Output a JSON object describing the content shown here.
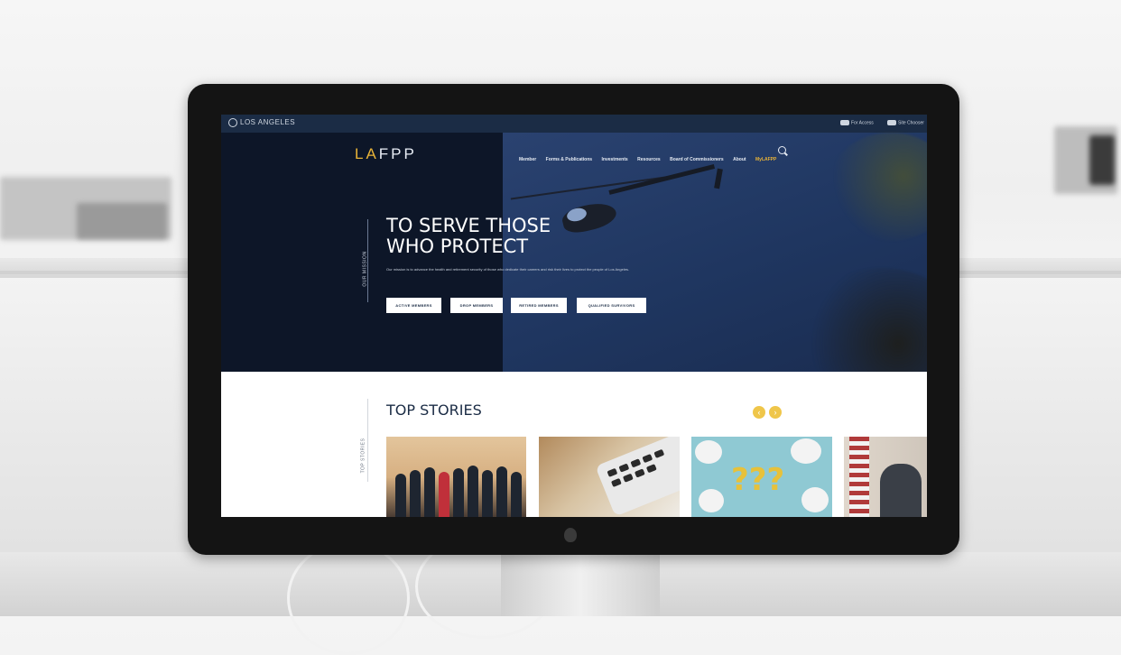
{
  "website": {
    "topbar": {
      "brand": "LOS ANGELES",
      "tools": [
        "For Access",
        "Site Chooser"
      ]
    },
    "logo": {
      "accent": "LA",
      "rest": "FPP"
    },
    "nav": {
      "items": [
        "Member",
        "Forms & Publications",
        "Investments",
        "Resources",
        "Board of Commissioners",
        "About",
        "MyLAFPP"
      ],
      "highlighted": "MyLAFPP"
    },
    "hero": {
      "side_label": "OUR MISSION",
      "title": "TO SERVE THOSE WHO PROTECT",
      "text": "Our mission is to advance the health and retirement security of those who dedicate their careers and risk their lives to protect the people of Los Angeles.",
      "buttons": [
        "ACTIVE MEMBERS",
        "DROP MEMBERS",
        "RETIRED MEMBERS",
        "QUALIFIED SURVIVORS"
      ]
    },
    "stories": {
      "side_label": "TOP STORIES",
      "title": "TOP STORIES",
      "prev_symbol": "‹",
      "next_symbol": "›",
      "question_marks": "???"
    }
  },
  "colors": {
    "nav_bar": "#1b2c45",
    "hero_dark": "#0d1628",
    "accent_gold": "#e8b338",
    "arrow_yellow": "#efc64a"
  }
}
